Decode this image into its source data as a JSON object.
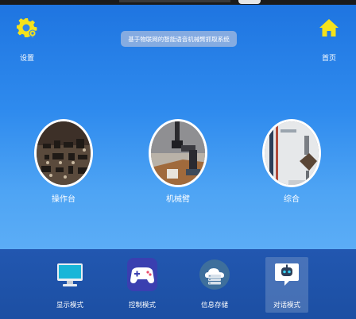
{
  "header": {
    "title": "基于物联网的智能语音机械臂抓取系统",
    "settings_label": "设置",
    "home_label": "首页"
  },
  "modes": [
    {
      "label": "操作台",
      "icon": "console-photo"
    },
    {
      "label": "机械臂",
      "icon": "robot-arm-photo"
    },
    {
      "label": "综合",
      "icon": "combined-photo"
    }
  ],
  "nav": [
    {
      "label": "显示模式",
      "icon": "monitor-icon"
    },
    {
      "label": "控制模式",
      "icon": "gamepad-icon"
    },
    {
      "label": "信息存储",
      "icon": "cloud-storage-icon"
    },
    {
      "label": "对话模式",
      "icon": "chat-robot-icon"
    }
  ],
  "colors": {
    "accent_yellow": "#f4e21c",
    "bottom_bar": "#1c4fa3",
    "background_top": "#1e74e0",
    "background_bottom": "#6cb8f8"
  }
}
